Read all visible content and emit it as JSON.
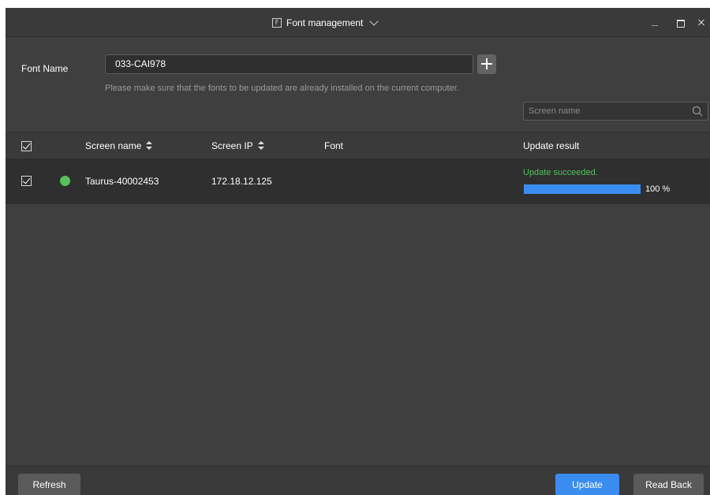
{
  "window": {
    "title": "Font management",
    "title_icon": "F"
  },
  "font_section": {
    "label": "Font Name",
    "input_value": "033-CAI978",
    "hint": "Please make sure that the fonts to be updated are already installed on the current computer."
  },
  "search": {
    "placeholder": "Screen name"
  },
  "table": {
    "columns": [
      "Screen name",
      "Screen IP",
      "Font",
      "Update result"
    ],
    "rows": [
      {
        "checked": true,
        "online": true,
        "screen_name": "Taurus-40002453",
        "screen_ip": "172.18.12.125",
        "font": "",
        "update_result": "Update succeeded.",
        "progress": 100,
        "progress_label": "100 %"
      }
    ]
  },
  "footer": {
    "refresh_label": "Refresh",
    "update_label": "Update",
    "read_back_label": "Read Back"
  },
  "colors": {
    "window_bg": "#3f3f3f",
    "accent": "#3b8cf0",
    "success": "#53c15a",
    "online_dot": "#56c25a"
  }
}
